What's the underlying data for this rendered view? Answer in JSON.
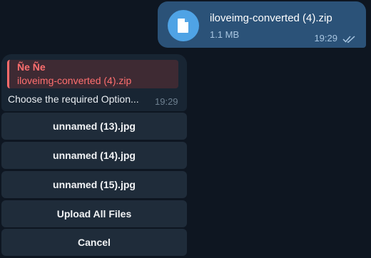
{
  "outgoing": {
    "file_name": "iloveimg-converted (4).zip",
    "file_size": "1.1 MB",
    "time": "19:29",
    "file_icon": "document-icon",
    "status_icon": "double-check-icon"
  },
  "incoming": {
    "reply_author": "Ñe Ñe",
    "reply_text": "iloveimg-converted (4).zip",
    "message": "Choose the required Option...",
    "time": "19:29"
  },
  "keyboard": {
    "buttons": [
      "unnamed (13).jpg",
      "unnamed (14).jpg",
      "unnamed (15).jpg",
      "Upload All Files",
      "Cancel"
    ]
  },
  "colors": {
    "background": "#0e1621",
    "outgoing_bubble": "#2b5278",
    "incoming_bubble": "#182533",
    "keyboard_button": "#1f2c3a",
    "accent": "#4fa3e5",
    "reply_accent": "#ff6b6b"
  }
}
